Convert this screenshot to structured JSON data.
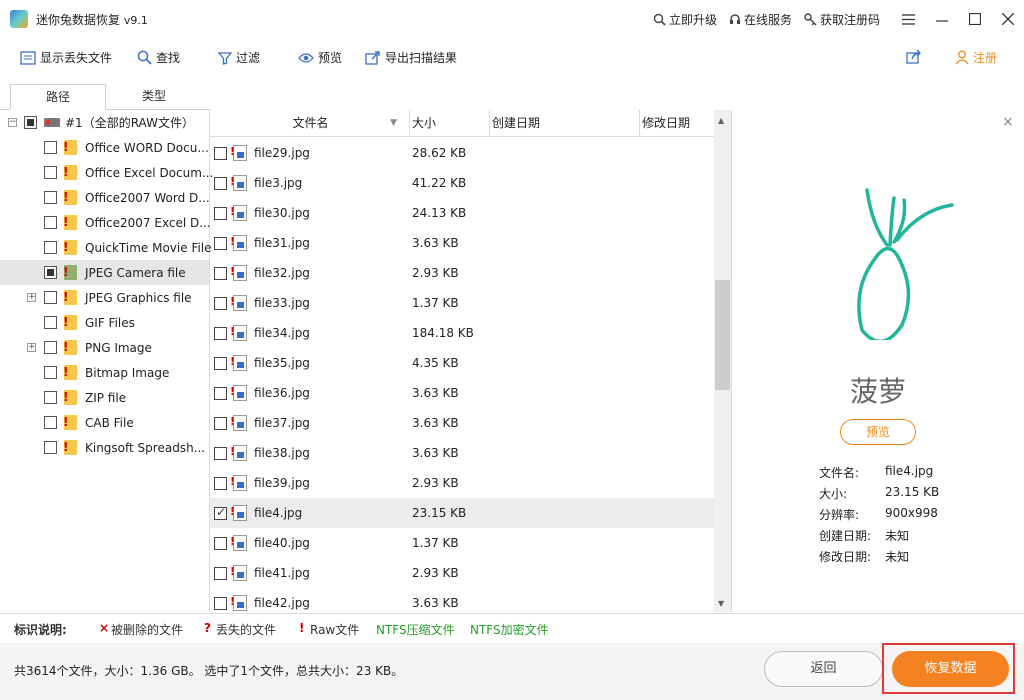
{
  "title_bar": {
    "app_title": "迷你兔数据恢复",
    "version": "v9.1",
    "links": [
      "立即升级",
      "在线服务",
      "获取注册码"
    ]
  },
  "toolbar": {
    "show_lost": "显示丢失文件",
    "find": "查找",
    "filter": "过滤",
    "preview": "预览",
    "export": "导出扫描结果",
    "register": "注册"
  },
  "tabs": [
    "路径",
    "类型"
  ],
  "tree": {
    "root": "#1（全部的RAW文件）",
    "items": [
      "Office WORD Docu...",
      "Office Excel Docum...",
      "Office2007 Word D...",
      "Office2007 Excel D...",
      "QuickTime Movie File",
      "JPEG Camera file",
      "JPEG Graphics file",
      "GIF Files",
      "PNG Image",
      "Bitmap Image",
      "ZIP file",
      "CAB File",
      "Kingsoft Spreadsh..."
    ]
  },
  "columns": [
    "文件名",
    "大小",
    "创建日期",
    "修改日期"
  ],
  "files": [
    {
      "name": "file29.jpg",
      "size": "28.62 KB"
    },
    {
      "name": "file3.jpg",
      "size": "41.22 KB"
    },
    {
      "name": "file30.jpg",
      "size": "24.13 KB"
    },
    {
      "name": "file31.jpg",
      "size": "3.63 KB"
    },
    {
      "name": "file32.jpg",
      "size": "2.93 KB"
    },
    {
      "name": "file33.jpg",
      "size": "1.37 KB"
    },
    {
      "name": "file34.jpg",
      "size": "184.18 KB"
    },
    {
      "name": "file35.jpg",
      "size": "4.35 KB"
    },
    {
      "name": "file36.jpg",
      "size": "3.63 KB"
    },
    {
      "name": "file37.jpg",
      "size": "3.63 KB"
    },
    {
      "name": "file38.jpg",
      "size": "3.63 KB"
    },
    {
      "name": "file39.jpg",
      "size": "2.93 KB"
    },
    {
      "name": "file4.jpg",
      "size": "23.15 KB"
    },
    {
      "name": "file40.jpg",
      "size": "1.37 KB"
    },
    {
      "name": "file41.jpg",
      "size": "2.93 KB"
    },
    {
      "name": "file42.jpg",
      "size": "3.63 KB"
    }
  ],
  "preview": {
    "caption": "菠萝",
    "button": "预览",
    "meta_labels": [
      "文件名:",
      "大小:",
      "分辨率:",
      "创建日期:",
      "修改日期:"
    ],
    "meta_values": [
      "file4.jpg",
      "23.15 KB",
      "900x998",
      "未知",
      "未知"
    ]
  },
  "legend": {
    "title": "标识说明:",
    "deleted": "被删除的文件",
    "lost": "丢失的文件",
    "raw": "Raw文件",
    "ntfs_compressed": "NTFS压缩文件",
    "ntfs_encrypted": "NTFS加密文件"
  },
  "status": {
    "text": "共3614个文件，大小：1.36 GB。 选中了1个文件，总共大小：23 KB。",
    "back": "返回",
    "recover": "恢复数据"
  },
  "colors": {
    "accent": "#f58220",
    "highlight_border": "#e03b3b",
    "preview_stroke": "#22b59a",
    "ntfs_green": "#2a9d2a",
    "mark_red": "#d00000"
  }
}
